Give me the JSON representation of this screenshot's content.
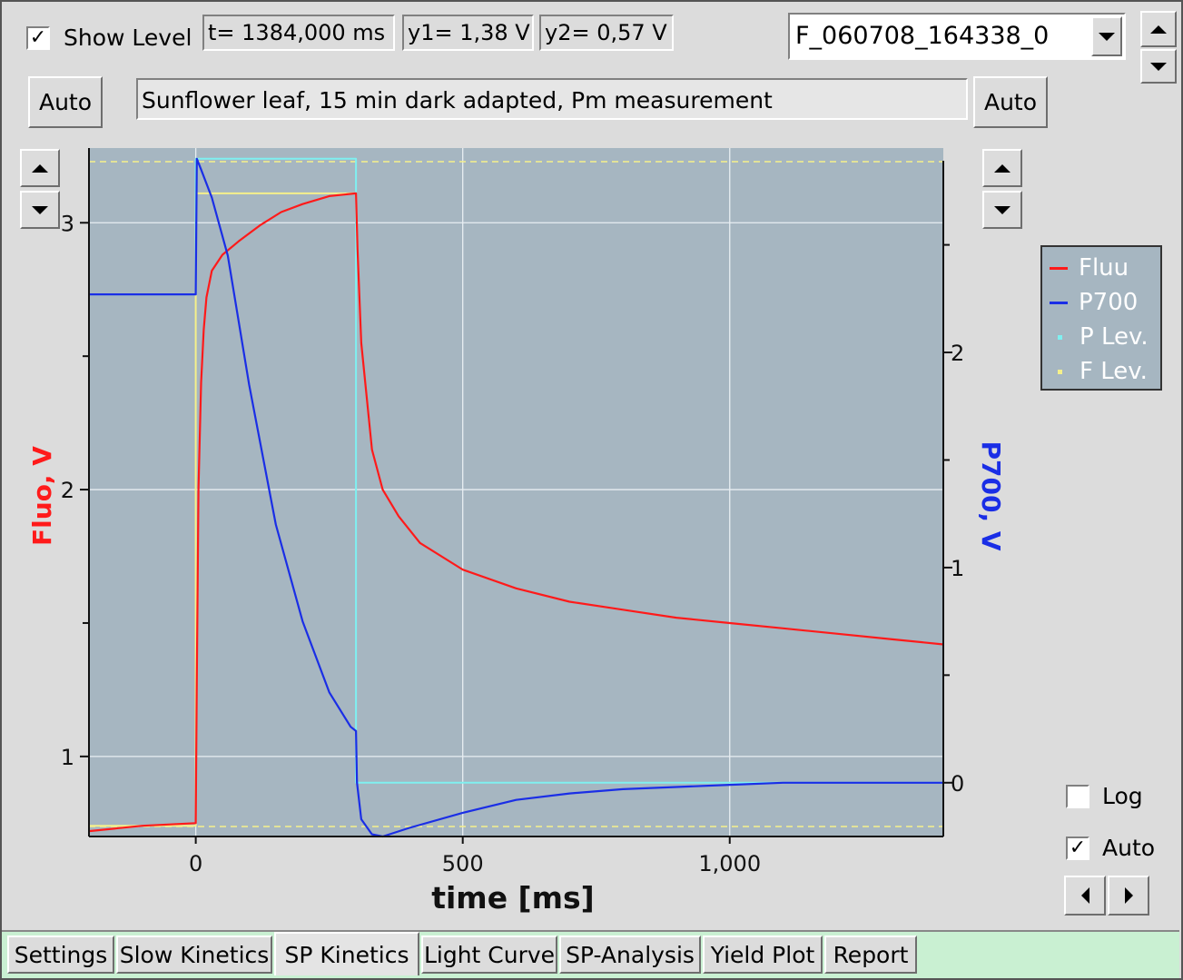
{
  "header": {
    "show_level_label": "Show Level",
    "show_level_checked": true,
    "t_readout": "t= 1384,000 ms",
    "y1_readout": "y1= 1,38 V",
    "y2_readout": "y2= 0,57 V",
    "file_select_value": "F_060708_164338_0"
  },
  "comment": {
    "auto_left_label": "Auto",
    "text": "Sunflower leaf, 15 min dark adapted, Pm measurement",
    "auto_right_label": "Auto"
  },
  "side": {
    "log_label": "Log",
    "log_checked": false,
    "auto_label": "Auto",
    "auto_checked": true
  },
  "tabs": [
    {
      "label": "Settings"
    },
    {
      "label": "Slow Kinetics"
    },
    {
      "label": "SP Kinetics",
      "active": true
    },
    {
      "label": "Light Curve"
    },
    {
      "label": "SP-Analysis"
    },
    {
      "label": "Yield Plot"
    },
    {
      "label": "Report"
    }
  ],
  "colors": {
    "plot_bg": "#a6b6c1",
    "fluo": "#ff1a1a",
    "p700": "#1a2ee6",
    "p_lev": "#7ff0f0",
    "f_lev": "#f5f08a",
    "tab_bar": "#c9f0d2"
  },
  "chart_data": {
    "type": "line",
    "xlabel": "time [ms]",
    "ylabel_left": "Fluo, V",
    "ylabel_right": "P700, V",
    "xlim": [
      -200,
      1400
    ],
    "ylim_left": [
      0.7,
      3.28
    ],
    "ylim_right": [
      -0.25,
      2.95
    ],
    "x_ticks": [
      0,
      500,
      1000
    ],
    "x_tick_labels": [
      "0",
      "500",
      "1,000"
    ],
    "y_left_ticks": [
      1,
      2,
      3
    ],
    "y_left_tick_labels": [
      "1",
      "2",
      "3"
    ],
    "y_right_ticks": [
      0,
      1,
      2
    ],
    "y_right_tick_labels": [
      "0",
      "1",
      "2"
    ],
    "grid": true,
    "legend": {
      "position": "top-right, outside plot",
      "entries": [
        "Fluu",
        "P700",
        "P Lev.",
        "F Lev."
      ]
    },
    "series": [
      {
        "name": "Fluu",
        "axis": "left",
        "x": [
          -200,
          -100,
          0,
          2,
          5,
          10,
          15,
          20,
          30,
          50,
          80,
          120,
          160,
          200,
          250,
          300,
          303,
          310,
          330,
          350,
          380,
          420,
          500,
          600,
          700,
          800,
          900,
          1000,
          1100,
          1200,
          1300,
          1400
        ],
        "y": [
          0.72,
          0.74,
          0.75,
          1.3,
          2.0,
          2.4,
          2.6,
          2.72,
          2.82,
          2.88,
          2.93,
          2.99,
          3.04,
          3.07,
          3.1,
          3.11,
          2.9,
          2.55,
          2.15,
          2.0,
          1.9,
          1.8,
          1.7,
          1.63,
          1.58,
          1.55,
          1.52,
          1.5,
          1.48,
          1.46,
          1.44,
          1.42
        ]
      },
      {
        "name": "P700",
        "axis": "right",
        "x": [
          -200,
          -100,
          0,
          2,
          10,
          30,
          60,
          100,
          150,
          200,
          250,
          290,
          300,
          302,
          310,
          330,
          350,
          400,
          500,
          600,
          700,
          800,
          900,
          1000,
          1100,
          1200,
          1300,
          1400
        ],
        "y": [
          2.27,
          2.27,
          2.27,
          2.9,
          2.85,
          2.72,
          2.45,
          1.85,
          1.2,
          0.75,
          0.42,
          0.26,
          0.24,
          0.0,
          -0.17,
          -0.24,
          -0.25,
          -0.21,
          -0.14,
          -0.08,
          -0.05,
          -0.03,
          -0.02,
          -0.01,
          0.0,
          0.0,
          0.0,
          0.0
        ]
      },
      {
        "name": "P Lev.",
        "axis": "right",
        "x": [
          -200,
          0,
          0,
          300,
          300,
          1400
        ],
        "y": [
          2.27,
          2.27,
          2.9,
          2.9,
          0.0,
          0.0
        ]
      },
      {
        "name": "F Lev.",
        "axis": "left",
        "x": [
          -200,
          0,
          0,
          300
        ],
        "y": [
          0.74,
          0.74,
          3.11,
          3.11
        ]
      }
    ]
  }
}
